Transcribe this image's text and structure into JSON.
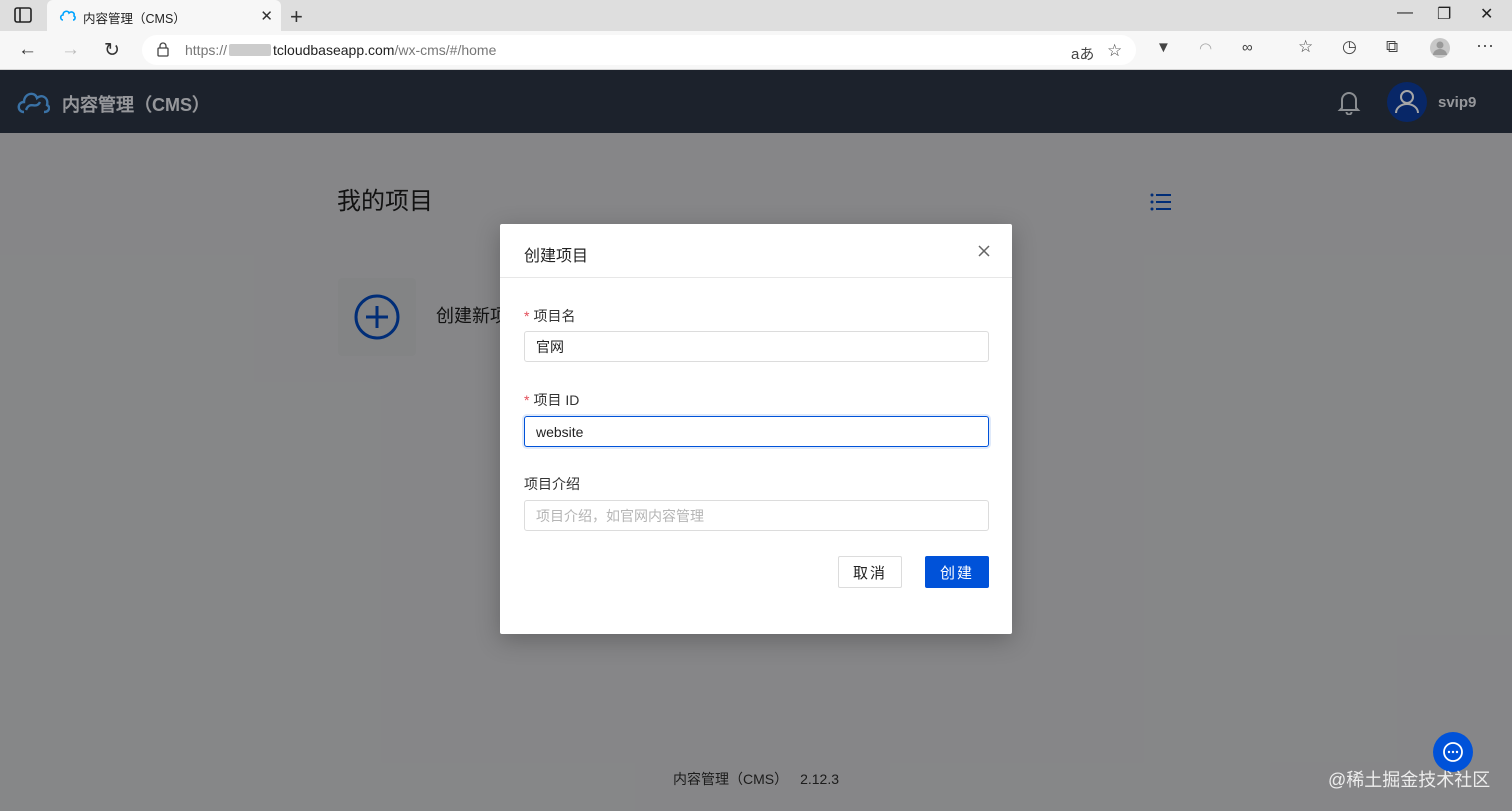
{
  "browser": {
    "tab_title": "内容管理（CMS）",
    "url_prefix": "https://",
    "url_host": "tcloudbaseapp.com",
    "url_path": "/wx-cms/#/home"
  },
  "header": {
    "app_title": "内容管理（CMS）",
    "username": "svip9"
  },
  "main": {
    "page_title": "我的项目",
    "create_new_label": "创建新项"
  },
  "dialog": {
    "title": "创建项目",
    "fields": [
      {
        "label": "项目名",
        "required": true,
        "value": "官网",
        "placeholder": ""
      },
      {
        "label": "项目 ID",
        "required": true,
        "value": "website",
        "placeholder": ""
      },
      {
        "label": "项目介绍",
        "required": false,
        "value": "",
        "placeholder": "项目介绍，如官网内容管理"
      }
    ],
    "cancel_label": "取消",
    "create_label": "创建"
  },
  "footer": {
    "app_name": "内容管理（CMS）",
    "version": "2.12.3"
  },
  "watermark": "@稀土掘金技术社区",
  "colors": {
    "primary": "#0052d9",
    "header_bg": "#2b3544",
    "required": "#e34d59"
  }
}
